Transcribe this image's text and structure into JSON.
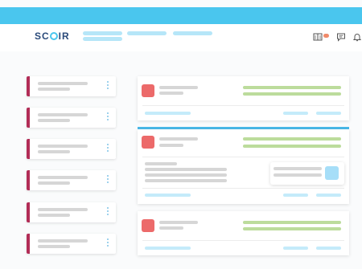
{
  "brand": {
    "logo_text_left": "SC",
    "logo_text_right": "IR"
  },
  "header": {
    "icons": [
      "book-icon",
      "chat-icon",
      "bell-icon"
    ]
  },
  "colors": {
    "top_strip": "#4ac6ee",
    "accent": "#b22d57",
    "red_square": "#ec6a6a",
    "green": "#bcdc9c",
    "light_blue": "#c4ebfa",
    "selection_line": "#4ab8e8"
  },
  "left_list_count": 6,
  "right_card_count": 3
}
